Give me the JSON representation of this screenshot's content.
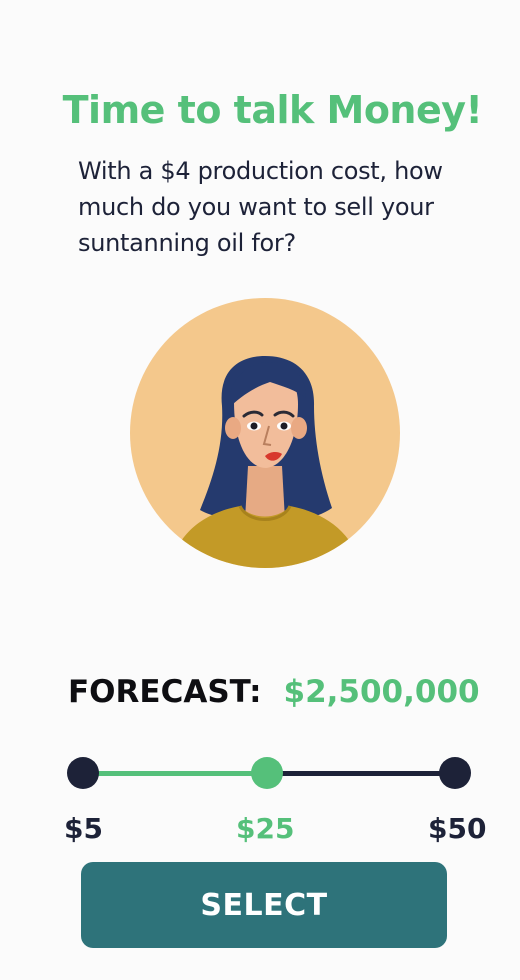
{
  "header": {
    "title": "Time to talk Money!",
    "question": "With a $4 production cost, how much do you want to sell your suntanning oil for?"
  },
  "avatar": {
    "icon": "woman-portrait-icon",
    "background_color": "#f4c88c",
    "hair_color": "#253a6e",
    "shirt_color": "#c39a27"
  },
  "forecast": {
    "label": "FORECAST:",
    "value": "$2,500,000"
  },
  "price_slider": {
    "min_label": "$5",
    "selected_label": "$25",
    "max_label": "$50",
    "selected_value": 25,
    "min": 5,
    "max": 50,
    "active_color": "#55c07a",
    "inactive_color": "#1d2238"
  },
  "actions": {
    "select_label": "SELECT",
    "select_color": "#2e737a"
  }
}
